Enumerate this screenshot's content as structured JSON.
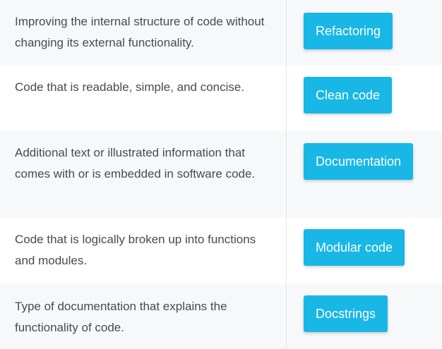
{
  "rows": [
    {
      "description": "Improving the internal structure of code without changing its external functionality.",
      "term": "Refactoring"
    },
    {
      "description": "Code that is readable, simple, and concise.",
      "term": "Clean code"
    },
    {
      "description": "Additional text or illustrated information that comes with or is embedded in software code.",
      "term": "Documentation"
    },
    {
      "description": "Code that is logically broken up into functions and modules.",
      "term": "Modular code"
    },
    {
      "description": "Type of documentation that explains the functionality of code.",
      "term": "Docstrings"
    }
  ],
  "colors": {
    "accent": "#18b7e6",
    "row_shaded": "#f6f8fa",
    "text": "#4a4a4a"
  }
}
